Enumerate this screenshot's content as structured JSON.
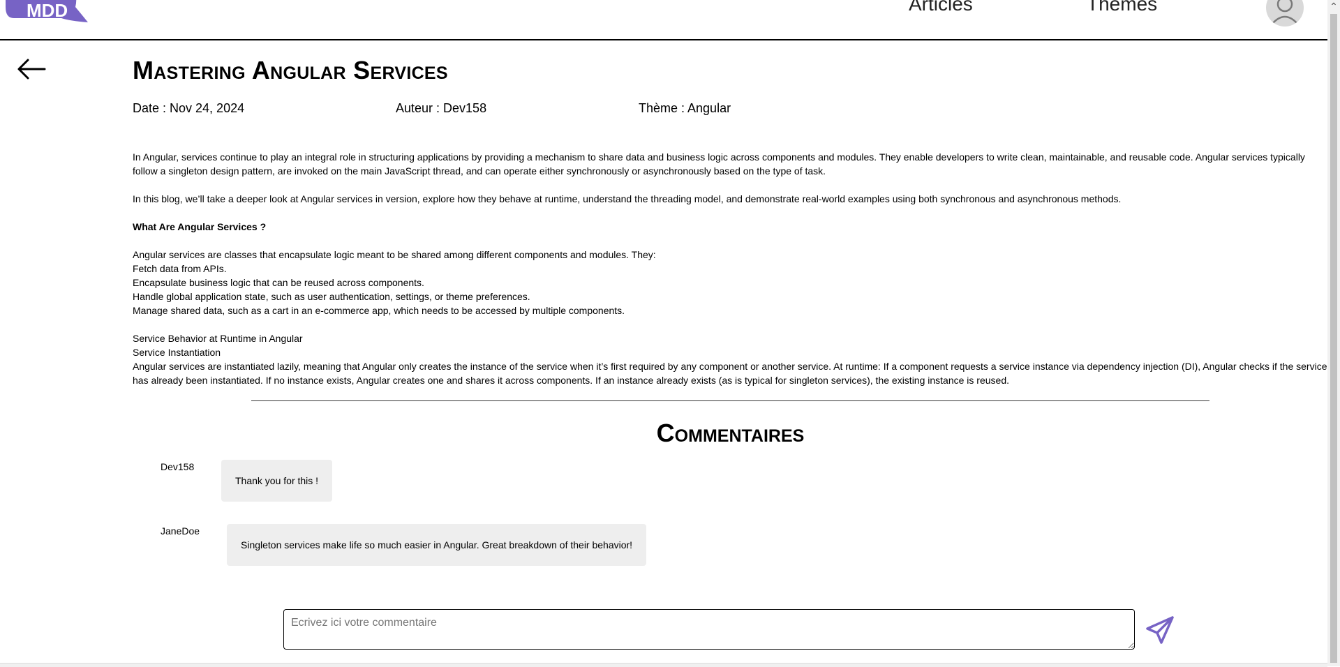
{
  "header": {
    "logo_text": "MDD",
    "nav": {
      "articles": "Articles",
      "themes": "Thèmes"
    },
    "avatar_icon": "user-icon"
  },
  "back_icon": "arrow-left-icon",
  "article": {
    "title": "Mastering Angular Services",
    "date": "Date : Nov 24, 2024",
    "author": "Auteur : Dev158",
    "theme": "Thème : Angular",
    "paragraphs": [
      "In Angular, services continue to play an integral role in structuring applications by providing a mechanism to share data and business logic across components and modules. They enable developers to write clean, maintainable, and reusable code. Angular services typically follow a singleton design pattern, are invoked on the main JavaScript thread, and can operate either synchronously or asynchronously based on the type of task.",
      "In this blog, we’ll take a deeper look at Angular services in version, explore how they behave at runtime, understand the threading model, and demonstrate real-world examples using both synchronous and asynchronous methods.",
      "What Are Angular Services ?",
      "Angular services are classes that encapsulate logic meant to be shared among different components and modules. They:",
      "Fetch data from APIs.",
      "Encapsulate business logic that can be reused across components.",
      "Handle global application state, such as user authentication, settings, or theme preferences.",
      "Manage shared data, such as a cart in an e-commerce app, which needs to be accessed by multiple components.",
      "Service Behavior at Runtime in Angular",
      "Service Instantiation",
      "Angular services are instantiated lazily, meaning that Angular only creates the instance of the service when it’s first required by any component or another service. At runtime: If a component requests a service instance via dependency injection (DI), Angular checks if the service has already been instantiated. If no instance exists, Angular creates one and shares it across components. If an instance already exists (as is typical for singleton services), the existing instance is reused."
    ]
  },
  "comments": {
    "title": "Commentaires",
    "items": [
      {
        "author": "Dev158",
        "text": "Thank you for this !"
      },
      {
        "author": "JaneDoe",
        "text": "Singleton services make life so much easier in Angular. Great breakdown of their behavior!"
      }
    ],
    "input_placeholder": "Ecrivez ici votre commentaire",
    "send_icon": "send-icon"
  },
  "colors": {
    "brand": "#7763c5",
    "bubble": "#eeeeee",
    "avatar": "#d9d9d9"
  }
}
